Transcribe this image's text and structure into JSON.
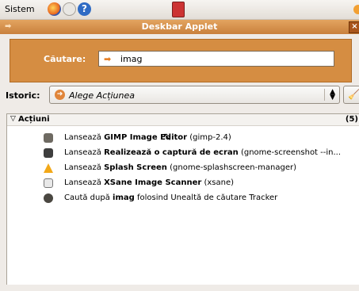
{
  "panel": {
    "menu_label": "Sistem",
    "help_glyph": "?"
  },
  "window": {
    "title": "Deskbar Applet",
    "close_glyph": "×"
  },
  "search": {
    "label": "Căutare:",
    "value": "imag"
  },
  "history": {
    "label": "Istoric:",
    "selected": "Alege Acțiunea"
  },
  "results": {
    "category": "Acțiuni",
    "count": "(5)",
    "items": [
      {
        "prefix": "Lansează ",
        "bold": "GIMP Image Editor",
        "suffix": " (gimp-2.4)",
        "icon": "gimp-icon"
      },
      {
        "prefix": "Lansează ",
        "bold": "Realizează o captură de ecran",
        "suffix": " (gnome-screenshot --in...",
        "icon": "camera-icon"
      },
      {
        "prefix": "Lansează ",
        "bold": "Splash Screen",
        "suffix": " (gnome-splashscreen-manager)",
        "icon": "splash-icon"
      },
      {
        "prefix": "Lansează ",
        "bold": "XSane Image Scanner",
        "suffix": " (xsane)",
        "icon": "scanner-icon"
      },
      {
        "prefix": "Caută după ",
        "bold": "imag",
        "suffix": " folosind Unealtă de căutare Tracker",
        "icon": "tracker-icon"
      }
    ]
  },
  "colors": {
    "accent": "#d58d42",
    "titlebar": "#c9803c",
    "background": "#efebe7"
  }
}
